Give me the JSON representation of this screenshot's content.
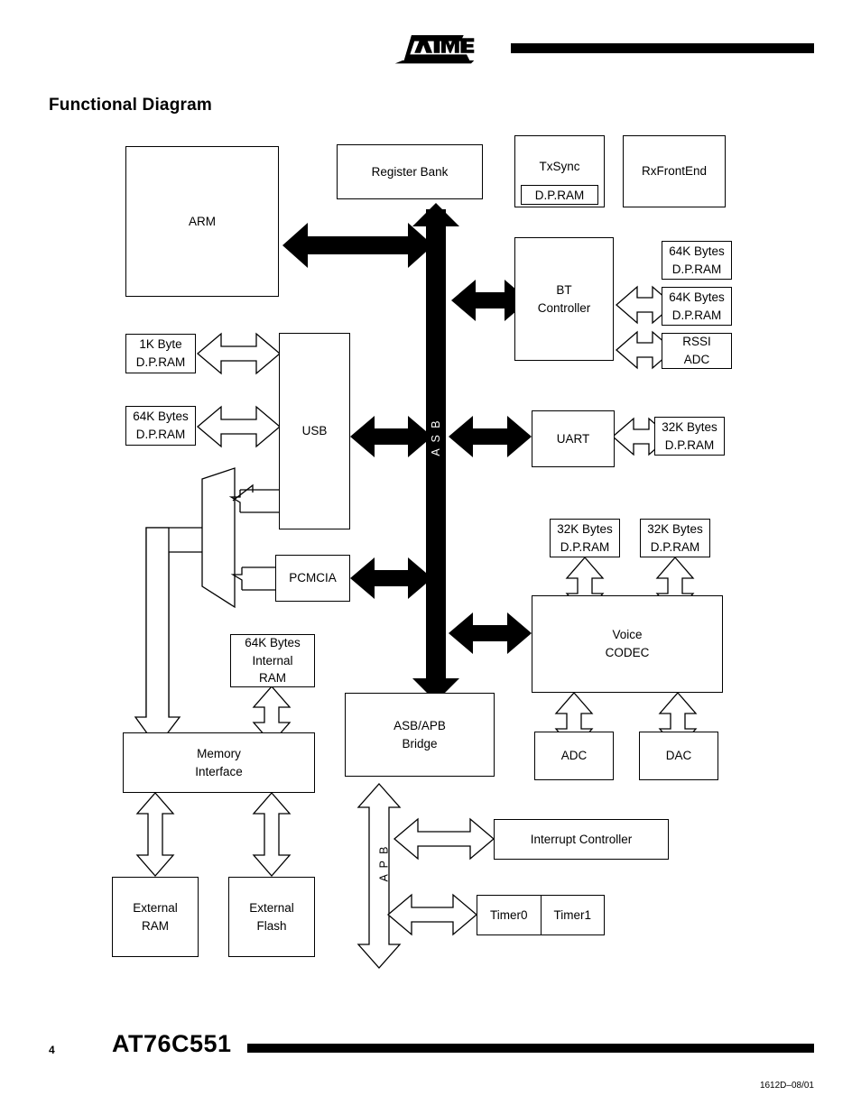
{
  "header": {
    "logo_alt": "ATMEL",
    "title": "Functional Diagram"
  },
  "footer": {
    "page_number": "4",
    "part_number": "AT76C551",
    "doc_code": "1612D–08/01"
  },
  "diagram": {
    "bus_asb_label": "A S B",
    "bus_apb_label": "A P B",
    "blocks": {
      "arm": "ARM",
      "register_bank": "Register Bank",
      "txsync": "TxSync",
      "txsync_ram": "D.P.RAM",
      "rxfrontend": "RxFrontEnd",
      "bt_controller_l1": "BT",
      "bt_controller_l2": "Controller",
      "bt_ram1_l1": "64K Bytes",
      "bt_ram1_l2": "D.P.RAM",
      "bt_ram2_l1": "64K Bytes",
      "bt_ram2_l2": "D.P.RAM",
      "rssi_l1": "RSSI",
      "rssi_l2": "ADC",
      "usb_ram1_l1": "1K Byte",
      "usb_ram1_l2": "D.P.RAM",
      "usb_ram2_l1": "64K Bytes",
      "usb_ram2_l2": "D.P.RAM",
      "usb": "USB",
      "uart": "UART",
      "uart_ram_l1": "32K Bytes",
      "uart_ram_l2": "D.P.RAM",
      "pcmcia": "PCMCIA",
      "voice_ram1_l1": "32K Bytes",
      "voice_ram1_l2": "D.P.RAM",
      "voice_ram2_l1": "32K Bytes",
      "voice_ram2_l2": "D.P.RAM",
      "voice_codec_l1": "Voice",
      "voice_codec_l2": "CODEC",
      "adc": "ADC",
      "dac": "DAC",
      "internal_ram_l1": "64K Bytes",
      "internal_ram_l2": "Internal",
      "internal_ram_l3": "RAM",
      "memory_interface_l1": "Memory",
      "memory_interface_l2": "Interface",
      "external_ram_l1": "External",
      "external_ram_l2": "RAM",
      "external_flash_l1": "External",
      "external_flash_l2": "Flash",
      "asb_apb_bridge_l1": "ASB/APB",
      "asb_apb_bridge_l2": "Bridge",
      "interrupt_controller": "Interrupt Controller",
      "timer0": "Timer0",
      "timer1": "Timer1"
    }
  }
}
